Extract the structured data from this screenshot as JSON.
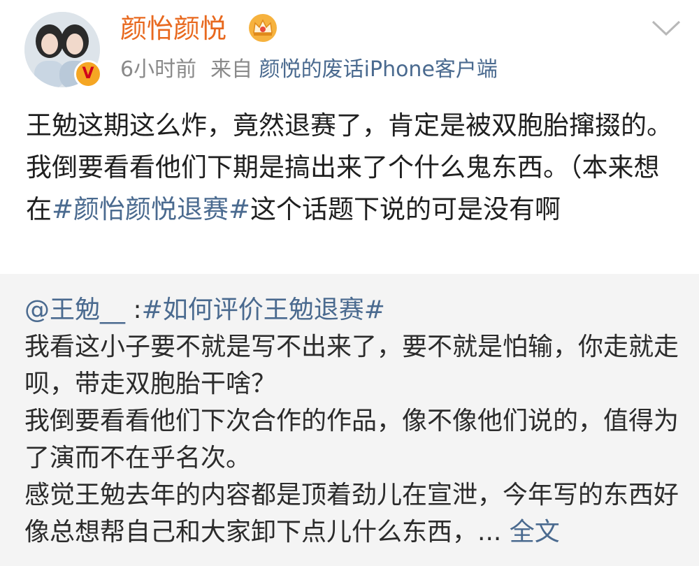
{
  "header": {
    "username": "颜怡颜悦",
    "time": "6小时前",
    "from_label": "来自",
    "source": "颜悦的废话iPhone客户端",
    "badge_letter": "V"
  },
  "post": {
    "text_before": "王勉这期这么炸，竟然退赛了，肯定是被双胞胎撺掇的。我倒要看看他们下期是搞出来了个什么鬼东西。（本来想在",
    "topic": "#颜怡颜悦退赛#",
    "text_after": "这个话题下说的可是没有啊"
  },
  "repost": {
    "mention": "@王勉__",
    "colon": " :",
    "topic": "#如何评价王勉退赛#",
    "para1": "我看这小子要不就是写不出来了，要不就是怕输，你走就走呗，带走双胞胎干啥？",
    "para2": "我倒要看看他们下次合作的作品，像不像他们说的，值得为了演而不在乎名次。",
    "para3": "感觉王勉去年的内容都是顶着劲儿在宣泄，今年写的东西好像总想帮自己和大家卸下点儿什么东西，... ",
    "full_text_link": "全文"
  },
  "colors": {
    "username": "#e8691f",
    "link": "#4a6a8f",
    "meta": "#8a8a8a",
    "repost_bg": "#f4f4f4"
  },
  "icons": {
    "avatar": "avatar-photo",
    "verified": "verified-badge-icon",
    "member": "crown-icon",
    "menu": "chevron-down-icon"
  }
}
